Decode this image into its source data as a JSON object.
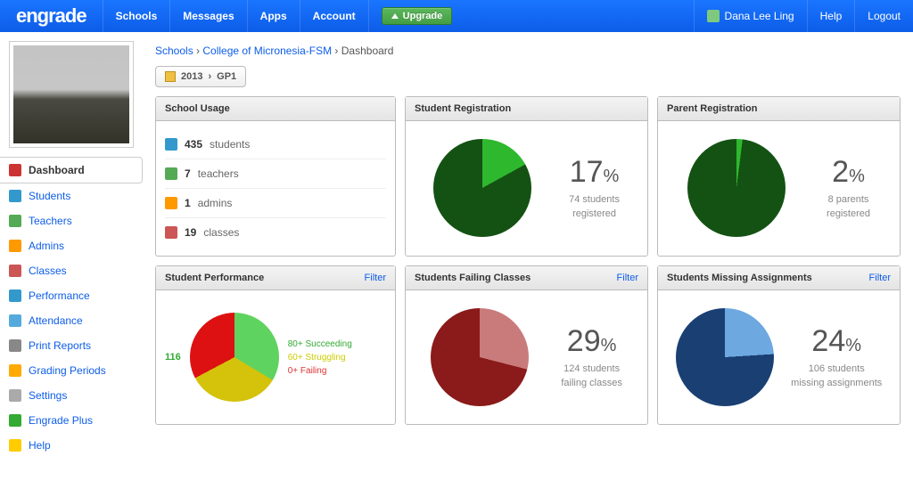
{
  "brand": "engrade",
  "topnav": [
    "Schools",
    "Messages",
    "Apps",
    "Account"
  ],
  "upgrade": "Upgrade",
  "user": {
    "name": "Dana Lee Ling"
  },
  "usernav": [
    "Help",
    "Logout"
  ],
  "crumb": {
    "a": "Schools",
    "b": "College of Micronesia-FSM",
    "c": "Dashboard"
  },
  "period": {
    "year": "2013",
    "gp": "GP1"
  },
  "sidenav": [
    {
      "label": "Dashboard",
      "active": true,
      "icon": "home"
    },
    {
      "label": "Students",
      "icon": "student"
    },
    {
      "label": "Teachers",
      "icon": "teacher"
    },
    {
      "label": "Admins",
      "icon": "admin"
    },
    {
      "label": "Classes",
      "icon": "classes"
    },
    {
      "label": "Performance",
      "icon": "perf"
    },
    {
      "label": "Attendance",
      "icon": "attend"
    },
    {
      "label": "Print Reports",
      "icon": "print"
    },
    {
      "label": "Grading Periods",
      "icon": "grading"
    },
    {
      "label": "Settings",
      "icon": "settings"
    },
    {
      "label": "Engrade Plus",
      "icon": "plus"
    },
    {
      "label": "Help",
      "icon": "help"
    }
  ],
  "usage": {
    "title": "School Usage",
    "items": [
      {
        "n": "435",
        "l": "students"
      },
      {
        "n": "7",
        "l": "teachers"
      },
      {
        "n": "1",
        "l": "admins"
      },
      {
        "n": "19",
        "l": "classes"
      }
    ]
  },
  "stud_reg": {
    "title": "Student Registration",
    "pct": "17",
    "unit": "%",
    "line1": "74 students",
    "line2": "registered"
  },
  "par_reg": {
    "title": "Parent Registration",
    "pct": "2",
    "unit": "%",
    "line1": "8 parents",
    "line2": "registered"
  },
  "perf": {
    "title": "Student Performance",
    "filter": "Filter",
    "count": "116",
    "leg1": "80+ Succeeding",
    "leg2": "60+ Struggling",
    "leg3": "0+ Failing"
  },
  "fail": {
    "title": "Students Failing Classes",
    "filter": "Filter",
    "pct": "29",
    "unit": "%",
    "line1": "124 students",
    "line2": "failing classes"
  },
  "miss": {
    "title": "Students Missing Assignments",
    "filter": "Filter",
    "pct": "24",
    "unit": "%",
    "line1": "106 students",
    "line2": "missing assignments"
  },
  "chart_data": [
    {
      "type": "pie",
      "title": "Student Registration",
      "series": [
        {
          "name": "registered",
          "value": 17,
          "color": "#2eb82e"
        },
        {
          "name": "not registered",
          "value": 83,
          "color": "#145214"
        }
      ]
    },
    {
      "type": "pie",
      "title": "Parent Registration",
      "series": [
        {
          "name": "registered",
          "value": 2,
          "color": "#2eb82e"
        },
        {
          "name": "not registered",
          "value": 98,
          "color": "#145214"
        }
      ]
    },
    {
      "type": "pie",
      "title": "Student Performance",
      "total": 116,
      "series": [
        {
          "name": "80+ Succeeding",
          "value": 39,
          "color": "#5fd35f"
        },
        {
          "name": "60+ Struggling",
          "value": 39,
          "color": "#d4c20b"
        },
        {
          "name": "0+ Failing",
          "value": 38,
          "color": "#d11"
        }
      ]
    },
    {
      "type": "pie",
      "title": "Students Failing Classes",
      "series": [
        {
          "name": "failing",
          "value": 29,
          "color": "#c97b7b"
        },
        {
          "name": "not failing",
          "value": 71,
          "color": "#8b1a1a"
        }
      ]
    },
    {
      "type": "pie",
      "title": "Students Missing Assignments",
      "series": [
        {
          "name": "missing",
          "value": 24,
          "color": "#6da8e0"
        },
        {
          "name": "not missing",
          "value": 76,
          "color": "#1a3f73"
        }
      ]
    }
  ],
  "colors": {
    "green_dark": "#145214",
    "green_light": "#2eb82e",
    "perf_g": "#5fd35f",
    "perf_y": "#d4c20b",
    "perf_r": "#d11",
    "red_dark": "#8b1a1a",
    "red_light": "#c97b7b",
    "blue_dark": "#1a3f73",
    "blue_light": "#6da8e0"
  }
}
